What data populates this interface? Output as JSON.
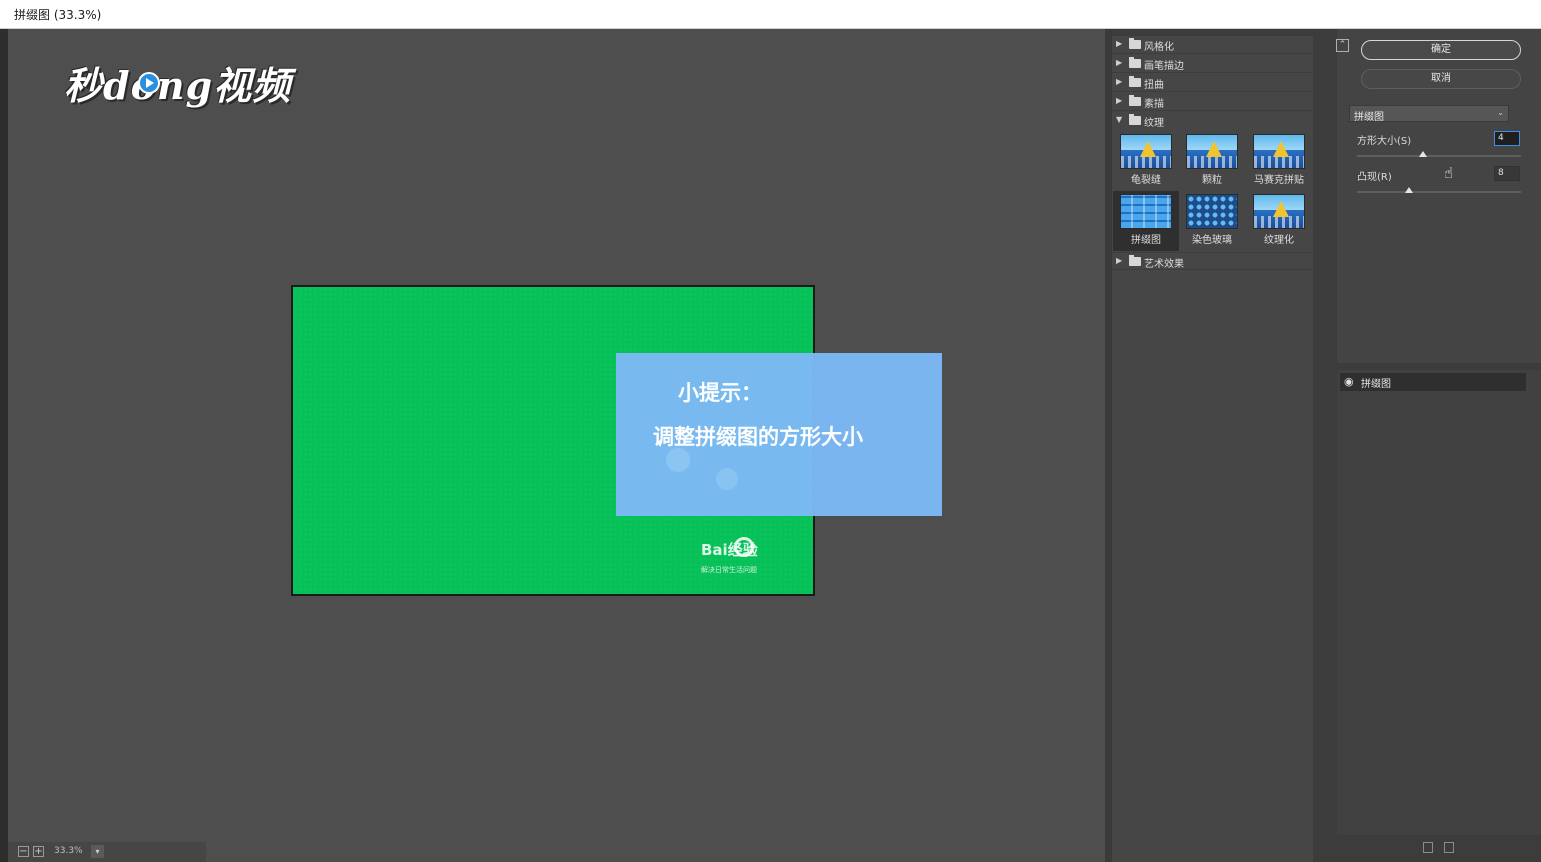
{
  "window": {
    "title": "拼缀图 (33.3%)"
  },
  "watermark": {
    "logo_text": "秒dong视频"
  },
  "document": {
    "tip_title": "小提示：",
    "tip_body": "调整拼缀图的方形大小",
    "baidu_logo": "Bai经验",
    "baidu_slogan": "解决日常生活问题",
    "fill_color": "#06c058",
    "tip_color": "#7db9f7"
  },
  "status": {
    "zoom": "33.3%"
  },
  "filter_gallery": {
    "categories": [
      {
        "label": "风格化",
        "expanded": false
      },
      {
        "label": "画笔描边",
        "expanded": false
      },
      {
        "label": "扭曲",
        "expanded": false
      },
      {
        "label": "素描",
        "expanded": false
      },
      {
        "label": "纹理",
        "expanded": true
      },
      {
        "label": "艺术效果",
        "expanded": false
      }
    ],
    "texture_filters": [
      {
        "label": "龟裂缝"
      },
      {
        "label": "颗粒"
      },
      {
        "label": "马赛克拼贴"
      },
      {
        "label": "拼缀图",
        "selected": true
      },
      {
        "label": "染色玻璃"
      },
      {
        "label": "纹理化"
      }
    ]
  },
  "settings": {
    "ok_label": "确定",
    "cancel_label": "取消",
    "filter_select": "拼缀图",
    "params": [
      {
        "label": "方形大小(S)",
        "value": "4",
        "slider": 0.4
      },
      {
        "label": "凸现(R)",
        "value": "8",
        "slider": 0.32
      }
    ]
  },
  "layers": {
    "items": [
      {
        "name": "拼缀图",
        "visible": true
      }
    ]
  }
}
